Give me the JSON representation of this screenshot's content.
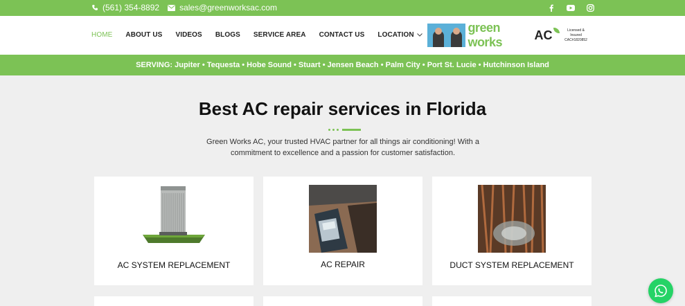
{
  "topbar": {
    "phone": "(561) 354-8892",
    "email": "sales@greenworksac.com",
    "social": [
      "facebook-icon",
      "youtube-icon",
      "instagram-icon"
    ]
  },
  "nav": {
    "items": [
      "HOME",
      "ABOUT US",
      "VIDEOS",
      "BLOGS",
      "SERVICE AREA",
      "CONTACT US",
      "LOCATION"
    ]
  },
  "logo": {
    "green": "green works",
    "ac": "AC",
    "licensed": "Licensed & Insured",
    "license_no": "CAC#1820852"
  },
  "serving": "SERVING: Jupiter • Tequesta • Hobe Sound • Stuart • Jensen Beach • Palm City • Port St. Lucie • Hutchinson Island",
  "hero": {
    "title": "Best AC repair services in Florida",
    "description": "Green Works AC, your trusted HVAC partner for all things air conditioning! With a commitment to excellence and a passion for customer satisfaction."
  },
  "cards": [
    {
      "title": "AC SYSTEM REPLACEMENT"
    },
    {
      "title": "AC REPAIR"
    },
    {
      "title": "DUCT SYSTEM REPLACEMENT"
    }
  ],
  "colors": {
    "brand_green": "#7cc255",
    "whatsapp": "#25d366"
  }
}
